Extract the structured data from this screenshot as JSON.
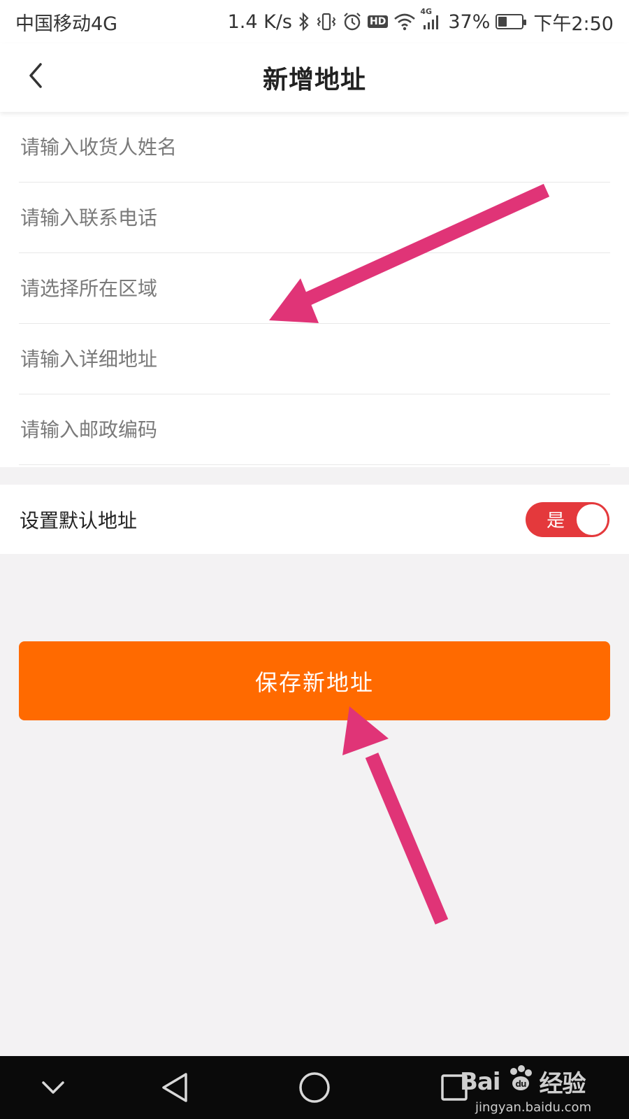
{
  "status_bar": {
    "carrier": "中国移动4G",
    "speed": "1.4 K/s",
    "hd": "HD",
    "network": "4G",
    "battery_text": "37%",
    "battery_level": 0.37,
    "time": "下午2:50"
  },
  "header": {
    "title": "新增地址",
    "back_icon": "chevron-left-icon"
  },
  "form": {
    "fields": [
      {
        "name": "recipient-name",
        "value": "",
        "placeholder": "请输入收货人姓名"
      },
      {
        "name": "phone",
        "value": "",
        "placeholder": "请输入联系电话"
      },
      {
        "name": "region",
        "value": "",
        "placeholder": "请选择所在区域"
      },
      {
        "name": "detail-address",
        "value": "",
        "placeholder": "请输入详细地址"
      },
      {
        "name": "postal-code",
        "value": "",
        "placeholder": "请输入邮政编码"
      }
    ]
  },
  "default_address": {
    "label": "设置默认地址",
    "toggle_text": "是",
    "enabled": true
  },
  "save_button": {
    "label": "保存新地址"
  },
  "watermark": {
    "logo_text": "Bai",
    "logo_text2": "经验",
    "url": "jingyan.baidu.com"
  },
  "colors": {
    "accent_orange": "#ff6a00",
    "toggle_red": "#e4393c",
    "annotation_pink": "#e03477",
    "background": "#f3f2f3"
  }
}
